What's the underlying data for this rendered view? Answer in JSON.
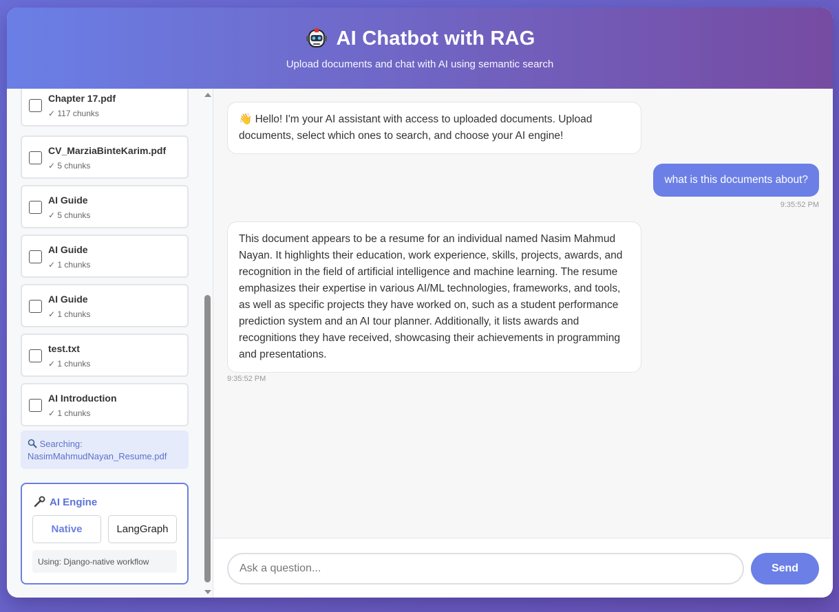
{
  "header": {
    "title": "AI Chatbot with RAG",
    "subtitle": "Upload documents and chat with AI using semantic search"
  },
  "documents": [
    {
      "name": "Chapter 17.pdf",
      "chunks": "✓ 117 chunks"
    },
    {
      "name": "CV_MarziaBinteKarim.pdf",
      "chunks": "✓ 5 chunks"
    },
    {
      "name": "AI Guide",
      "chunks": "✓ 5 chunks"
    },
    {
      "name": "AI Guide",
      "chunks": "✓ 1 chunks"
    },
    {
      "name": "AI Guide",
      "chunks": "✓ 1 chunks"
    },
    {
      "name": "test.txt",
      "chunks": "✓ 1 chunks"
    },
    {
      "name": "AI Introduction",
      "chunks": "✓ 1 chunks"
    }
  ],
  "searching": {
    "label": "Searching:",
    "file": "NasimMahmudNayan_Resume.pdf"
  },
  "engine": {
    "title": "AI Engine",
    "native_label": "Native",
    "langgraph_label": "LangGraph",
    "using": "Using: Django-native workflow"
  },
  "messages": {
    "welcome": "👋 Hello! I'm your AI assistant with access to uploaded documents. Upload documents, select which ones to search, and choose your AI engine!",
    "user_question": "what is this documents about?",
    "user_time": "9:35:52 PM",
    "answer": "This document appears to be a resume for an individual named Nasim Mahmud Nayan. It highlights their education, work experience, skills, projects, awards, and recognition in the field of artificial intelligence and machine learning. The resume emphasizes their expertise in various AI/ML technologies, frameworks, and tools, as well as specific projects they have worked on, such as a student performance prediction system and an AI tour planner. Additionally, it lists awards and recognitions they have received, showcasing their achievements in programming and presentations.",
    "answer_time": "9:35:52 PM"
  },
  "input": {
    "placeholder": "Ask a question...",
    "value": "",
    "send_label": "Send"
  },
  "colors": {
    "accent": "#6b7fe6",
    "header_start": "#6a7fe6",
    "header_end": "#764ba2"
  }
}
